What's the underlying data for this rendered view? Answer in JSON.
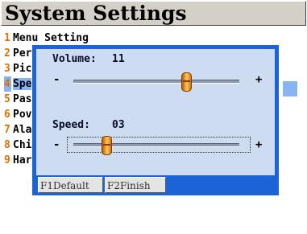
{
  "title": "System Settings",
  "menu": {
    "items": [
      {
        "num": "1",
        "label": "Menu Setting"
      },
      {
        "num": "2",
        "label": "Per"
      },
      {
        "num": "3",
        "label": "Pic"
      },
      {
        "num": "4",
        "label": "Spe"
      },
      {
        "num": "5",
        "label": "Pas"
      },
      {
        "num": "6",
        "label": "Pov"
      },
      {
        "num": "7",
        "label": "Ala"
      },
      {
        "num": "8",
        "label": "Chi"
      },
      {
        "num": "9",
        "label": "Har"
      }
    ],
    "selected_index": 3
  },
  "dialog": {
    "volume": {
      "label": "Volume:",
      "value": "11",
      "level": 0.68,
      "minus": "-",
      "plus": "+"
    },
    "speed": {
      "label": "Speed:",
      "value": "03",
      "level": 0.2,
      "minus": "-",
      "plus": "+"
    },
    "buttons": {
      "default_label": "F1Default",
      "finish_label": "F2Finish"
    }
  },
  "colors": {
    "accent": "#1b63d6",
    "selection": "#86b4f4",
    "menu_number": "#e07000",
    "dialog_bg": "#cedcf2"
  }
}
